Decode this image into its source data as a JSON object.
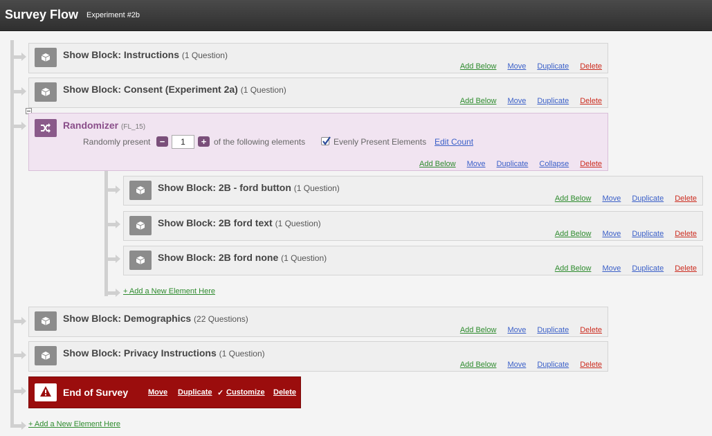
{
  "header": {
    "title": "Survey Flow",
    "subtitle": "Experiment #2b"
  },
  "actions": {
    "add_below": "Add Below",
    "move": "Move",
    "duplicate": "Duplicate",
    "delete": "Delete",
    "collapse": "Collapse"
  },
  "blocks": [
    {
      "title": "Show Block: Instructions",
      "count": "(1 Question)"
    },
    {
      "title": "Show Block: Consent (Experiment 2a)",
      "count": "(1 Question)"
    },
    {
      "title": "Show Block: 2B - ford button",
      "count": "(1 Question)"
    },
    {
      "title": "Show Block: 2B ford text",
      "count": "(1 Question)"
    },
    {
      "title": "Show Block: 2B ford none",
      "count": "(1 Question)"
    },
    {
      "title": "Show Block: Demographics",
      "count": "(22 Questions)"
    },
    {
      "title": "Show Block: Privacy Instructions",
      "count": "(1 Question)"
    }
  ],
  "randomizer": {
    "title": "Randomizer",
    "id": "(FL_15)",
    "randomly_present": "Randomly present",
    "minus": "−",
    "count": "1",
    "plus": "+",
    "following": "of the following elements",
    "evenly_label": "Evenly Present Elements",
    "evenly_checked": true,
    "edit_count": "Edit Count"
  },
  "end_of_survey": {
    "title": "End of Survey",
    "move": "Move",
    "duplicate": "Duplicate",
    "check": "✓",
    "customize": "Customize",
    "delete": "Delete"
  },
  "add_new_inner": "+ Add a New Element Here",
  "add_new_outer": "+ Add a New Element Here",
  "colors": {
    "add": "#2e8b2e",
    "link": "#3a5fc8",
    "delete": "#cc2b1e",
    "end_of_survey": "#9b0d0d",
    "randomizer": "#f1e4f1"
  }
}
